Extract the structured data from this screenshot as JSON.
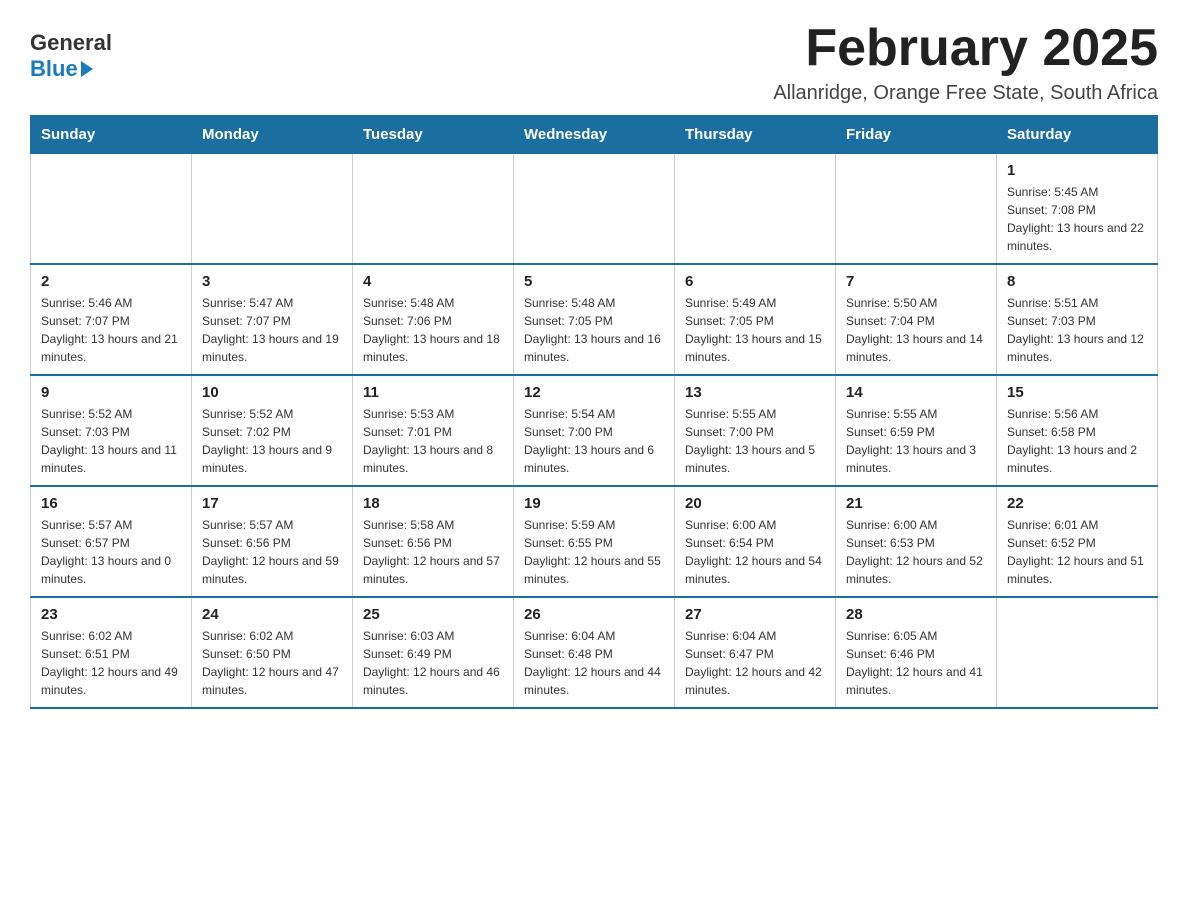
{
  "logo": {
    "general": "General",
    "blue": "Blue"
  },
  "title": "February 2025",
  "subtitle": "Allanridge, Orange Free State, South Africa",
  "headers": [
    "Sunday",
    "Monday",
    "Tuesday",
    "Wednesday",
    "Thursday",
    "Friday",
    "Saturday"
  ],
  "weeks": [
    [
      {
        "day": "",
        "info": ""
      },
      {
        "day": "",
        "info": ""
      },
      {
        "day": "",
        "info": ""
      },
      {
        "day": "",
        "info": ""
      },
      {
        "day": "",
        "info": ""
      },
      {
        "day": "",
        "info": ""
      },
      {
        "day": "1",
        "info": "Sunrise: 5:45 AM\nSunset: 7:08 PM\nDaylight: 13 hours and 22 minutes."
      }
    ],
    [
      {
        "day": "2",
        "info": "Sunrise: 5:46 AM\nSunset: 7:07 PM\nDaylight: 13 hours and 21 minutes."
      },
      {
        "day": "3",
        "info": "Sunrise: 5:47 AM\nSunset: 7:07 PM\nDaylight: 13 hours and 19 minutes."
      },
      {
        "day": "4",
        "info": "Sunrise: 5:48 AM\nSunset: 7:06 PM\nDaylight: 13 hours and 18 minutes."
      },
      {
        "day": "5",
        "info": "Sunrise: 5:48 AM\nSunset: 7:05 PM\nDaylight: 13 hours and 16 minutes."
      },
      {
        "day": "6",
        "info": "Sunrise: 5:49 AM\nSunset: 7:05 PM\nDaylight: 13 hours and 15 minutes."
      },
      {
        "day": "7",
        "info": "Sunrise: 5:50 AM\nSunset: 7:04 PM\nDaylight: 13 hours and 14 minutes."
      },
      {
        "day": "8",
        "info": "Sunrise: 5:51 AM\nSunset: 7:03 PM\nDaylight: 13 hours and 12 minutes."
      }
    ],
    [
      {
        "day": "9",
        "info": "Sunrise: 5:52 AM\nSunset: 7:03 PM\nDaylight: 13 hours and 11 minutes."
      },
      {
        "day": "10",
        "info": "Sunrise: 5:52 AM\nSunset: 7:02 PM\nDaylight: 13 hours and 9 minutes."
      },
      {
        "day": "11",
        "info": "Sunrise: 5:53 AM\nSunset: 7:01 PM\nDaylight: 13 hours and 8 minutes."
      },
      {
        "day": "12",
        "info": "Sunrise: 5:54 AM\nSunset: 7:00 PM\nDaylight: 13 hours and 6 minutes."
      },
      {
        "day": "13",
        "info": "Sunrise: 5:55 AM\nSunset: 7:00 PM\nDaylight: 13 hours and 5 minutes."
      },
      {
        "day": "14",
        "info": "Sunrise: 5:55 AM\nSunset: 6:59 PM\nDaylight: 13 hours and 3 minutes."
      },
      {
        "day": "15",
        "info": "Sunrise: 5:56 AM\nSunset: 6:58 PM\nDaylight: 13 hours and 2 minutes."
      }
    ],
    [
      {
        "day": "16",
        "info": "Sunrise: 5:57 AM\nSunset: 6:57 PM\nDaylight: 13 hours and 0 minutes."
      },
      {
        "day": "17",
        "info": "Sunrise: 5:57 AM\nSunset: 6:56 PM\nDaylight: 12 hours and 59 minutes."
      },
      {
        "day": "18",
        "info": "Sunrise: 5:58 AM\nSunset: 6:56 PM\nDaylight: 12 hours and 57 minutes."
      },
      {
        "day": "19",
        "info": "Sunrise: 5:59 AM\nSunset: 6:55 PM\nDaylight: 12 hours and 55 minutes."
      },
      {
        "day": "20",
        "info": "Sunrise: 6:00 AM\nSunset: 6:54 PM\nDaylight: 12 hours and 54 minutes."
      },
      {
        "day": "21",
        "info": "Sunrise: 6:00 AM\nSunset: 6:53 PM\nDaylight: 12 hours and 52 minutes."
      },
      {
        "day": "22",
        "info": "Sunrise: 6:01 AM\nSunset: 6:52 PM\nDaylight: 12 hours and 51 minutes."
      }
    ],
    [
      {
        "day": "23",
        "info": "Sunrise: 6:02 AM\nSunset: 6:51 PM\nDaylight: 12 hours and 49 minutes."
      },
      {
        "day": "24",
        "info": "Sunrise: 6:02 AM\nSunset: 6:50 PM\nDaylight: 12 hours and 47 minutes."
      },
      {
        "day": "25",
        "info": "Sunrise: 6:03 AM\nSunset: 6:49 PM\nDaylight: 12 hours and 46 minutes."
      },
      {
        "day": "26",
        "info": "Sunrise: 6:04 AM\nSunset: 6:48 PM\nDaylight: 12 hours and 44 minutes."
      },
      {
        "day": "27",
        "info": "Sunrise: 6:04 AM\nSunset: 6:47 PM\nDaylight: 12 hours and 42 minutes."
      },
      {
        "day": "28",
        "info": "Sunrise: 6:05 AM\nSunset: 6:46 PM\nDaylight: 12 hours and 41 minutes."
      },
      {
        "day": "",
        "info": ""
      }
    ]
  ]
}
